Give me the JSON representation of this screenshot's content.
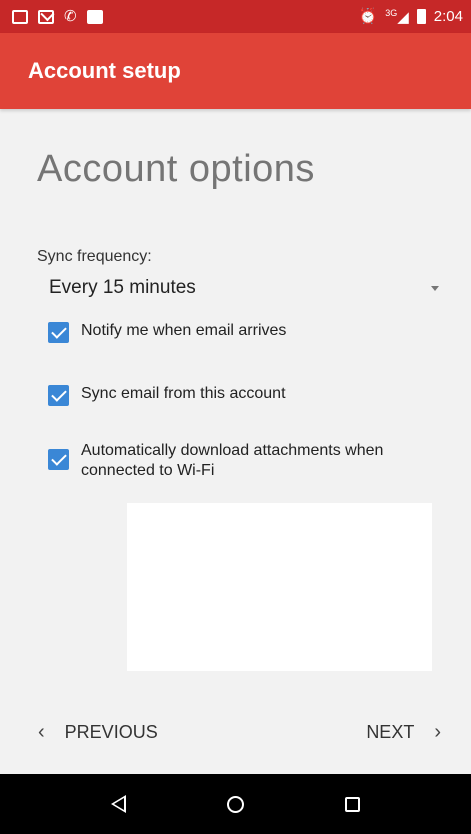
{
  "status_bar": {
    "time": "2:04",
    "network": "3G",
    "icons": [
      "image-icon",
      "mail-icon",
      "missed-call-icon",
      "shopping-bag-icon",
      "alarm-icon",
      "signal-icon",
      "battery-icon"
    ]
  },
  "app_bar": {
    "title": "Account setup"
  },
  "main": {
    "heading": "Account options",
    "sync_frequency": {
      "label": "Sync frequency:",
      "value": "Every 15 minutes"
    },
    "options": [
      {
        "label": "Notify me when email arrives",
        "checked": true
      },
      {
        "label": "Sync email from this account",
        "checked": true
      },
      {
        "label": "Automatically download attachments when connected to Wi-Fi",
        "checked": true
      }
    ]
  },
  "footer": {
    "previous_label": "PREVIOUS",
    "next_label": "NEXT"
  },
  "colors": {
    "status_bar": "#c62828",
    "app_bar": "#e04338",
    "checkbox": "#3a87d6",
    "background": "#f2f2f2"
  }
}
